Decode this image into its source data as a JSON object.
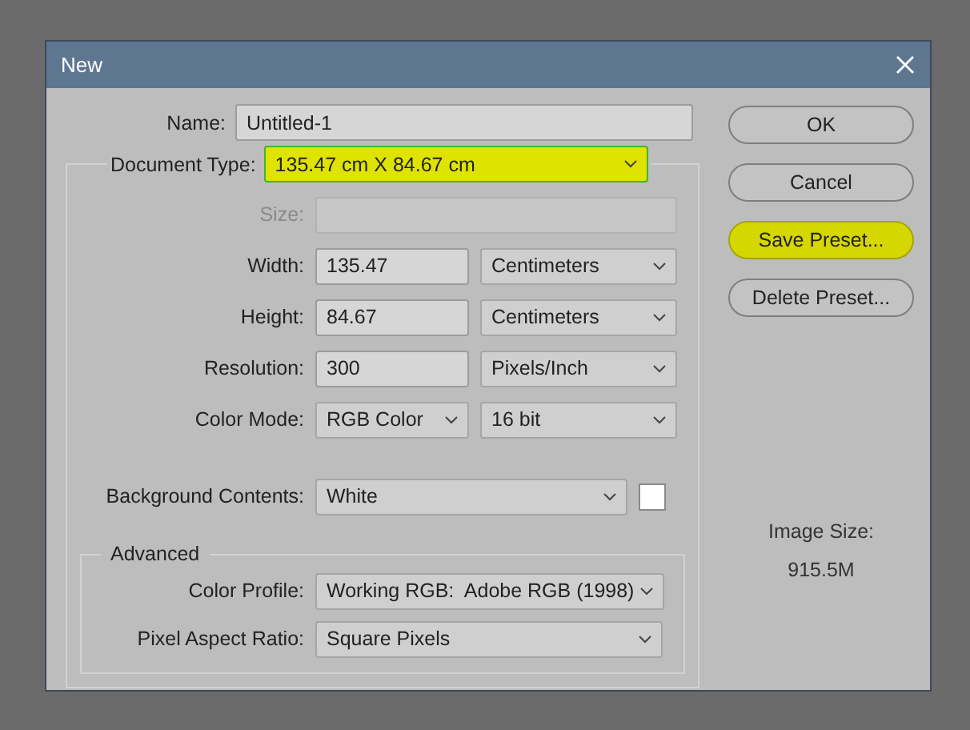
{
  "window": {
    "title": "New"
  },
  "name_field": {
    "label": "Name:",
    "value": "Untitled-1"
  },
  "document_type": {
    "label": "Document Type:",
    "value": "135.47 cm X 84.67 cm",
    "highlighted": true
  },
  "rows": [
    {
      "label": "Size:",
      "disabled": true,
      "controls": [
        {
          "kind": "select"
        }
      ]
    },
    {
      "label": "Width:",
      "disabled": false,
      "controls": [
        {
          "kind": "text",
          "value": "135.47"
        },
        {
          "kind": "select",
          "value": "Centimeters"
        }
      ]
    },
    {
      "label": "Height:",
      "disabled": false,
      "controls": [
        {
          "kind": "text",
          "value": "84.67"
        },
        {
          "kind": "select",
          "value": "Centimeters"
        }
      ]
    },
    {
      "label": "Resolution:",
      "disabled": false,
      "controls": [
        {
          "kind": "text",
          "value": "300"
        },
        {
          "kind": "select",
          "value": "Pixels/Inch"
        }
      ]
    },
    {
      "label": "Color Mode:",
      "disabled": false,
      "controls": [
        {
          "kind": "select",
          "value": "RGB Color"
        },
        {
          "kind": "select",
          "value": "16 bit"
        }
      ]
    },
    {
      "label": "Background Contents:",
      "disabled": false,
      "controls": [
        {
          "kind": "select",
          "value": "White"
        },
        {
          "kind": "swatch",
          "color": "#ffffff"
        }
      ]
    }
  ],
  "advanced": {
    "title": "Advanced",
    "rows": [
      {
        "label": "Color Profile:",
        "disabled": false,
        "controls": [
          {
            "kind": "select",
            "value": "Working RGB:  Adobe RGB (1998)"
          }
        ]
      },
      {
        "label": "Pixel Aspect Ratio:",
        "disabled": false,
        "controls": [
          {
            "kind": "select",
            "value": "Square Pixels"
          }
        ]
      }
    ]
  },
  "buttons": [
    {
      "label": "OK",
      "highlighted": false
    },
    {
      "label": "Cancel",
      "highlighted": false
    },
    {
      "label": "Save Preset...",
      "highlighted": true
    },
    {
      "label": "Delete Preset...",
      "highlighted": false
    }
  ],
  "image_size": {
    "label": "Image Size:",
    "value": "915.5M"
  }
}
